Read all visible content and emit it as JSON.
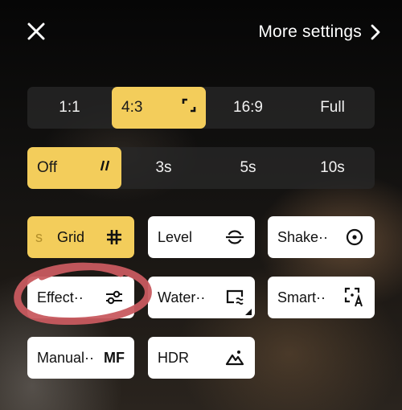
{
  "header": {
    "close_icon": "close-icon",
    "more_settings_label": "More settings",
    "more_settings_icon": "chevron-right-icon"
  },
  "aspect_ratio": {
    "options": [
      {
        "label": "1:1",
        "active": false
      },
      {
        "label": "4:3",
        "active": true,
        "icon": "expand-corners-icon"
      },
      {
        "label": "16:9",
        "active": false
      },
      {
        "label": "Full",
        "active": false
      }
    ]
  },
  "timer": {
    "options": [
      {
        "label": "Off",
        "active": true,
        "icon": "double-slash-icon"
      },
      {
        "label": "3s",
        "active": false
      },
      {
        "label": "5s",
        "active": false
      },
      {
        "label": "10s",
        "active": false
      }
    ]
  },
  "tiles": [
    {
      "label": "Grid",
      "prefix": "s",
      "icon": "grid-icon",
      "active": true
    },
    {
      "label": "Level",
      "icon": "level-icon",
      "active": false
    },
    {
      "label": "Shake··",
      "icon": "shake-icon",
      "active": false
    },
    {
      "label": "Effect··",
      "icon": "sliders-icon",
      "active": false
    },
    {
      "label": "Water··",
      "icon": "watermark-icon",
      "active": false
    },
    {
      "label": "Smart··",
      "icon": "smart-text-icon",
      "active": false
    },
    {
      "label": "Manual··",
      "icon_text": "MF",
      "active": false
    },
    {
      "label": "HDR",
      "icon": "mountain-icon",
      "active": false
    }
  ],
  "colors": {
    "accent": "#f3cd5b",
    "tile_bg": "#ffffff",
    "annotation": "#c85a5f"
  }
}
